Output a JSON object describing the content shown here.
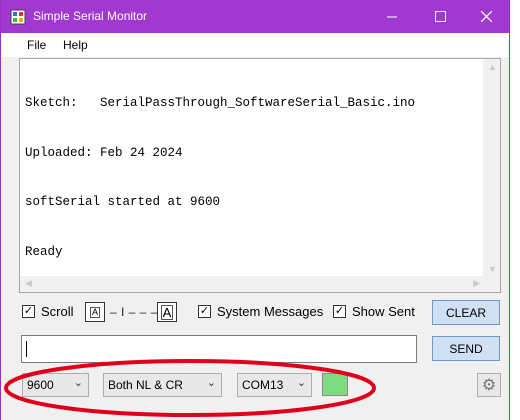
{
  "window": {
    "title": "Simple Serial Monitor",
    "accent_color": "#a139d0",
    "controls": {
      "minimize": "—",
      "maximize": "☐",
      "close": "✕"
    }
  },
  "menu": {
    "items": [
      "File",
      "Help"
    ]
  },
  "output": {
    "lines": [
      "Sketch:   SerialPassThrough_SoftwareSerial_Basic.ino",
      "Uploaded: Feb 24 2024",
      "softSerial started at 9600",
      "Ready"
    ]
  },
  "options": {
    "scroll_label": "Scroll",
    "scroll_checked": true,
    "font_small_glyph": "A",
    "font_large_glyph": "A",
    "font_slider_text": "– I – – –",
    "system_messages_label": "System Messages",
    "system_messages_checked": true,
    "show_sent_label": "Show Sent",
    "show_sent_checked": true,
    "check_glyph": "✓",
    "clear_button": "CLEAR"
  },
  "send": {
    "input_value": "",
    "button": "SEND"
  },
  "status_bar": {
    "baud_rate": "9600",
    "line_ending": "Both NL & CR",
    "port": "COM13",
    "connection_color": "#7fdb7f",
    "settings_icon": "gear-icon"
  },
  "annotation": {
    "color": "#e0001a",
    "shape": "ellipse"
  }
}
